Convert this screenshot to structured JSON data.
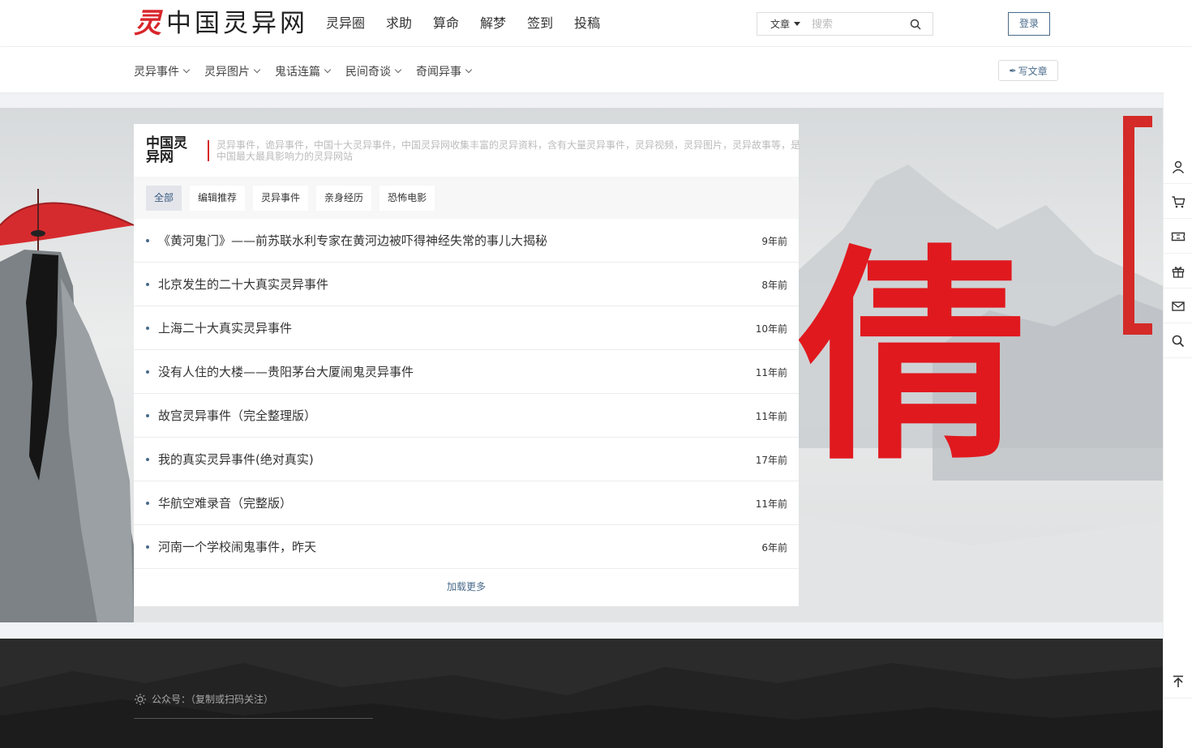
{
  "header": {
    "logo_mark": "灵",
    "logo_text": "中国灵异网",
    "nav": [
      "灵异圈",
      "求助",
      "算命",
      "解梦",
      "签到",
      "投稿"
    ],
    "search_type": "文章",
    "search_placeholder": "搜索",
    "login_label": "登录"
  },
  "subnav": {
    "categories": [
      "灵异事件",
      "灵异图片",
      "鬼话连篇",
      "民间奇谈",
      "奇闻异事"
    ],
    "write_label": "写文章"
  },
  "hero": {
    "red_char": "倩"
  },
  "card": {
    "title": "中国灵异网",
    "description": "灵异事件，诡异事件，中国十大灵异事件，中国灵异网收集丰富的灵异资料，含有大量灵异事件，灵异视频，灵异图片，灵异故事等，是中国最大最具影响力的灵异网站",
    "filters": [
      "全部",
      "编辑推荐",
      "灵异事件",
      "亲身经历",
      "恐怖电影"
    ],
    "active_filter": "全部",
    "items": [
      {
        "title": "《黄河鬼门》——前苏联水利专家在黄河边被吓得神经失常的事儿大揭秘",
        "time": "9年前"
      },
      {
        "title": "北京发生的二十大真实灵异事件",
        "time": "8年前"
      },
      {
        "title": "上海二十大真实灵异事件",
        "time": "10年前"
      },
      {
        "title": "没有人住的大楼——贵阳茅台大厦闹鬼灵异事件",
        "time": "11年前"
      },
      {
        "title": "故宫灵异事件（完全整理版）",
        "time": "11年前"
      },
      {
        "title": "我的真实灵异事件(绝对真实)",
        "time": "17年前"
      },
      {
        "title": "华航空难录音（完整版）",
        "time": "11年前"
      },
      {
        "title": "河南一个学校闹鬼事件，昨天",
        "time": "6年前"
      }
    ],
    "load_more": "加载更多"
  },
  "footer": {
    "gzh_label": "公众号：（复制或扫码关注）"
  },
  "colors": {
    "brand_red": "#d42a28",
    "accent_blue": "#4a6b8a"
  },
  "sidebar_icons": [
    "user-icon",
    "cart-icon",
    "ticket-icon",
    "gift-icon",
    "mail-icon",
    "search-icon",
    "back-to-top-icon"
  ]
}
